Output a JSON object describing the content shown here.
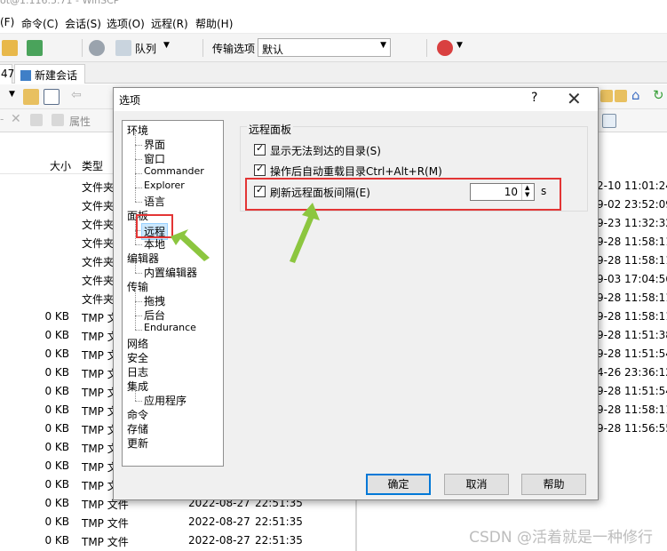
{
  "window": {
    "title_fragment": "(F)  命令(C)  会话(S)  选项(O)  远程(R)  帮助(H)"
  },
  "menu": [
    {
      "label": "(F)"
    },
    {
      "label": "命令(C)"
    },
    {
      "label": "会话(S)"
    },
    {
      "label": "选项(O)"
    },
    {
      "label": "远程(R)"
    },
    {
      "label": "帮助(H)"
    }
  ],
  "toolbar": {
    "queue_label": "队列",
    "transfer_label": "传输选项",
    "transfer_value": "默认"
  },
  "tabs": {
    "prev_tab": "47",
    "new_session": "新建会话"
  },
  "toolbar3": {
    "properties": "属性"
  },
  "columns": {
    "size": "大小",
    "type": "类型"
  },
  "files": [
    {
      "size": "",
      "type": "文件夹",
      "date": "",
      "time": ""
    },
    {
      "size": "",
      "type": "文件夹",
      "date": "",
      "time": ""
    },
    {
      "size": "",
      "type": "文件夹",
      "date": "",
      "time": ""
    },
    {
      "size": "",
      "type": "文件夹",
      "date": "",
      "time": ""
    },
    {
      "size": "",
      "type": "文件夹",
      "date": "",
      "time": ""
    },
    {
      "size": "",
      "type": "文件夹",
      "date": "",
      "time": ""
    },
    {
      "size": "",
      "type": "文件夹",
      "date": "",
      "time": ""
    },
    {
      "size": "0 KB",
      "type": "TMP 文",
      "date": "",
      "time": ""
    },
    {
      "size": "0 KB",
      "type": "TMP 文",
      "date": "",
      "time": ""
    },
    {
      "size": "0 KB",
      "type": "TMP 文",
      "date": "",
      "time": ""
    },
    {
      "size": "0 KB",
      "type": "TMP 文",
      "date": "",
      "time": ""
    },
    {
      "size": "0 KB",
      "type": "TMP 文",
      "date": "",
      "time": ""
    },
    {
      "size": "0 KB",
      "type": "TMP 文",
      "date": "",
      "time": ""
    },
    {
      "size": "0 KB",
      "type": "TMP 文",
      "date": "",
      "time": ""
    },
    {
      "size": "0 KB",
      "type": "TMP 文",
      "date": "",
      "time": ""
    },
    {
      "size": "0 KB",
      "type": "TMP 文",
      "date": "",
      "time": ""
    },
    {
      "size": "0 KB",
      "type": "TMP 文",
      "date": "",
      "time": ""
    },
    {
      "size": "0 KB",
      "type": "TMP 文件",
      "date": "2022-08-27",
      "time": "22:51:35"
    },
    {
      "size": "0 KB",
      "type": "TMP 文件",
      "date": "2022-08-27",
      "time": "22:51:35"
    },
    {
      "size": "0 KB",
      "type": "TMP 文件",
      "date": "2022-08-27",
      "time": "22:51:35"
    }
  ],
  "remote_times": [
    "2-10 11:01:24",
    "9-02 23:52:09",
    "9-23 11:32:32",
    "9-28 11:58:11",
    "9-28 11:58:11",
    "9-03 17:04:56",
    "9-28 11:58:11",
    "9-28 11:58:11",
    "9-28 11:51:38",
    "9-28 11:51:54",
    "4-26 23:36:12",
    "9-28 11:51:54",
    "9-28 11:58:11",
    "9-28 11:56:55"
  ],
  "dialog": {
    "title": "选项",
    "help_glyph": "?",
    "close_glyph": "✕",
    "tree": [
      {
        "label": "环境",
        "level": 0
      },
      {
        "label": "界面",
        "level": 1
      },
      {
        "label": "窗口",
        "level": 1
      },
      {
        "label": "Commander",
        "level": 1
      },
      {
        "label": "Explorer",
        "level": 1
      },
      {
        "label": "语言",
        "level": 1
      },
      {
        "label": "面板",
        "level": 0
      },
      {
        "label": "远程",
        "level": 1,
        "selected": true
      },
      {
        "label": "本地",
        "level": 1
      },
      {
        "label": "编辑器",
        "level": 0
      },
      {
        "label": "内置编辑器",
        "level": 1
      },
      {
        "label": "传输",
        "level": 0
      },
      {
        "label": "拖拽",
        "level": 1
      },
      {
        "label": "后台",
        "level": 1
      },
      {
        "label": "Endurance",
        "level": 1
      },
      {
        "label": "网络",
        "level": 0
      },
      {
        "label": "安全",
        "level": 0
      },
      {
        "label": "日志",
        "level": 0
      },
      {
        "label": "集成",
        "level": 0
      },
      {
        "label": "应用程序",
        "level": 1
      },
      {
        "label": "命令",
        "level": 0
      },
      {
        "label": "存储",
        "level": 0
      },
      {
        "label": "更新",
        "level": 0
      }
    ],
    "group_title": "远程面板",
    "options": [
      {
        "label": "显示无法到达的目录(S)",
        "checked": true
      },
      {
        "label": "操作后自动重载目录Ctrl+Alt+R(M)",
        "checked": true
      },
      {
        "label": "刷新远程面板间隔(E)",
        "checked": true
      }
    ],
    "interval_value": "10",
    "interval_unit": "s",
    "buttons": {
      "ok": "确定",
      "cancel": "取消",
      "help": "帮助"
    }
  },
  "annotation": {
    "highlight_color": "#e33535",
    "arrow_color": "#8cc63f"
  },
  "watermark": "CSDN @活着就是一种修行"
}
